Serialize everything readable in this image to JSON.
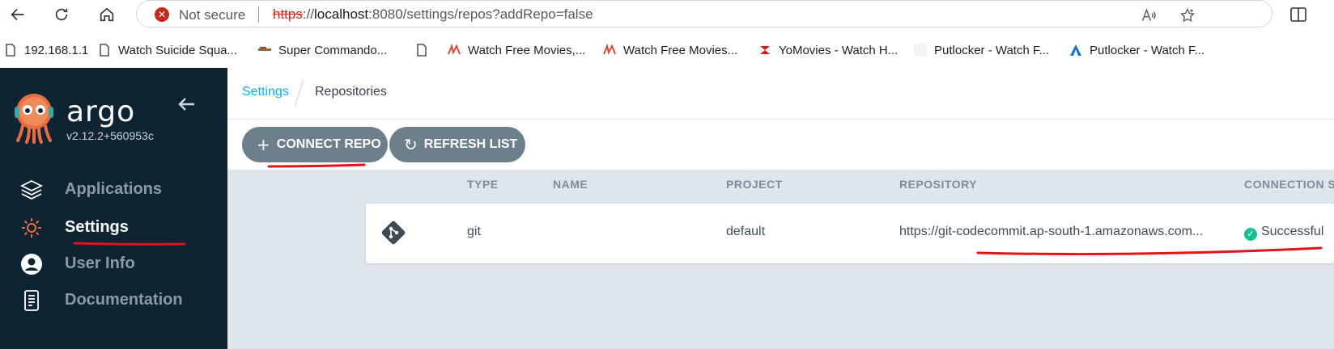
{
  "browser": {
    "security_label": "Not secure",
    "url_scheme": "https",
    "url_host": "localhost",
    "url_rest": ":8080/settings/repos?addRepo=false",
    "bookmarks": [
      {
        "label": "192.168.1.1",
        "icon": "page-icon"
      },
      {
        "label": "Watch Suicide Squa...",
        "icon": "page-icon"
      },
      {
        "label": "Super Commando...",
        "icon": "site-icon"
      },
      {
        "label": "",
        "icon": "page-icon"
      },
      {
        "label": "Watch Free Movies,...",
        "icon": "site-icon"
      },
      {
        "label": "Watch Free Movies...",
        "icon": "site-icon"
      },
      {
        "label": "YoMovies - Watch H...",
        "icon": "site-icon"
      },
      {
        "label": "Putlocker - Watch F...",
        "icon": "site-icon"
      },
      {
        "label": "Putlocker - Watch F...",
        "icon": "site-icon"
      }
    ]
  },
  "sidebar": {
    "brand": "argo",
    "version": "v2.12.2+560953c",
    "items": [
      {
        "label": "Applications",
        "icon": "layers-icon"
      },
      {
        "label": "Settings",
        "icon": "gear-icon"
      },
      {
        "label": "User Info",
        "icon": "user-icon"
      },
      {
        "label": "Documentation",
        "icon": "book-icon"
      }
    ]
  },
  "breadcrumb": {
    "parent": "Settings",
    "current": "Repositories"
  },
  "toolbar": {
    "connect_label": "CONNECT REPO",
    "refresh_label": "REFRESH LIST"
  },
  "table": {
    "columns": [
      "TYPE",
      "NAME",
      "PROJECT",
      "REPOSITORY",
      "CONNECTION ST"
    ],
    "rows": [
      {
        "type": "git",
        "name": "",
        "project": "default",
        "repository": "https://git-codecommit.ap-south-1.amazonaws.com...",
        "status": "Successful"
      }
    ]
  },
  "colors": {
    "sidebar_bg": "#0e2433",
    "button_bg": "#6d7f8b",
    "link": "#0dadea",
    "success": "#18be94",
    "annotation": "#e0121a"
  }
}
